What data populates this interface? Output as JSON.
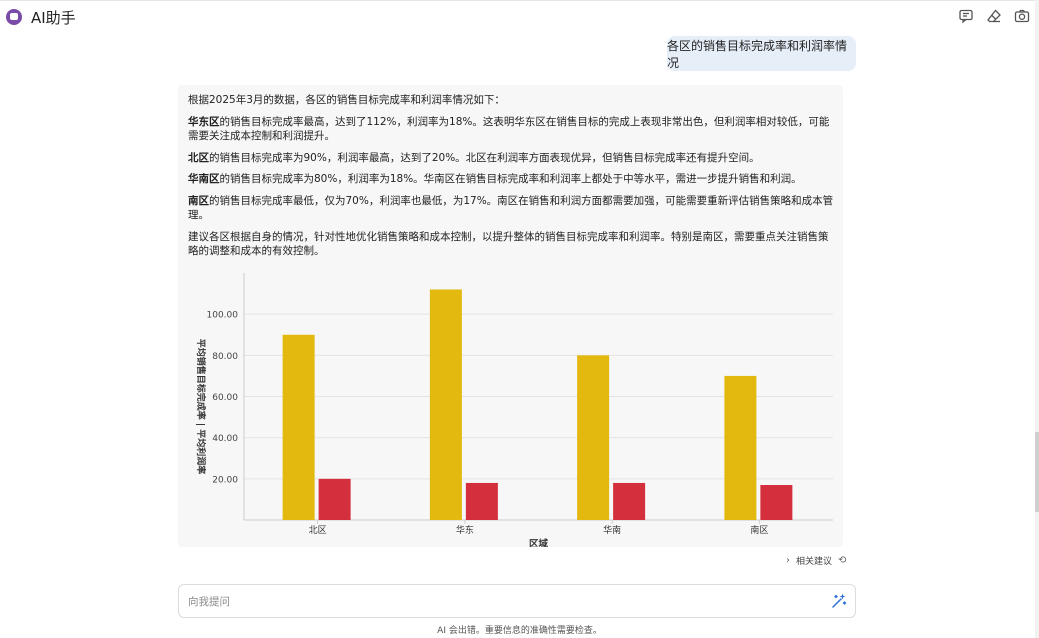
{
  "app": {
    "title": "AI助手",
    "accent": "#7a4aa8"
  },
  "toolbar": {
    "icons": [
      "feedback-icon",
      "eraser-icon",
      "camera-icon"
    ]
  },
  "conversation": {
    "user_message": "各区的销售目标完成率和利润率情况",
    "answer": {
      "intro": "根据2025年3月的数据，各区的销售目标完成率和利润率情况如下：",
      "paragraphs": [
        {
          "region": "华东区",
          "text": "的销售目标完成率最高，达到了112%，利润率为18%。这表明华东区在销售目标的完成上表现非常出色，但利润率相对较低，可能需要关注成本控制和利润提升。"
        },
        {
          "region": "北区",
          "text": "的销售目标完成率为90%，利润率最高，达到了20%。北区在利润率方面表现优异，但销售目标完成率还有提升空间。"
        },
        {
          "region": "华南区",
          "text": "的销售目标完成率为80%，利润率为18%。华南区在销售目标完成率和利润率上都处于中等水平，需进一步提升销售和利润。"
        },
        {
          "region": "南区",
          "text": "的销售目标完成率最低，仅为70%，利润率也最低，为17%。南区在销售和利润方面都需要加强，可能需要重新评估销售策略和成本管理。"
        }
      ],
      "conclusion": "建议各区根据自身的情况，针对性地优化销售策略和成本控制，以提升整体的销售目标完成率和利润率。特别是南区，需要重点关注销售策略的调整和成本的有效控制。"
    }
  },
  "chart_data": {
    "type": "bar",
    "categories": [
      "北区",
      "华东",
      "华南",
      "南区"
    ],
    "series": [
      {
        "name": "平均销售目标完成率",
        "values": [
          90,
          112,
          80,
          70
        ],
        "color": "#e3b90f"
      },
      {
        "name": "平均利润率",
        "values": [
          20,
          18,
          18,
          17
        ],
        "color": "#d42f3c"
      }
    ],
    "xlabel": "区域",
    "ylabel": "平均销售目标完成率 | 平均利润率",
    "yticks": [
      "20.00",
      "40.00",
      "60.00",
      "80.00",
      "100.00"
    ],
    "ylim": [
      0,
      120
    ],
    "grid": true,
    "legend": "none"
  },
  "suggestions": {
    "label": "相关建议"
  },
  "input": {
    "placeholder": "向我提问"
  },
  "footer": {
    "note": "AI 会出错。重要信息的准确性需要检查。"
  }
}
